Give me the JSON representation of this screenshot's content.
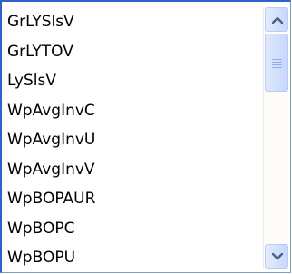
{
  "list": {
    "items": [
      "GrLYSlsV",
      "GrLYTOV",
      "LySlsV",
      "WpAvgInvC",
      "WpAvgInvU",
      "WpAvgInvV",
      "WpBOPAUR",
      "WpBOPC",
      "WpBOPU"
    ]
  },
  "scrollbar": {
    "up_icon": "chevron-up-icon",
    "down_icon": "chevron-down-icon",
    "arrow_color": "#4d6185",
    "position": 0.0
  }
}
